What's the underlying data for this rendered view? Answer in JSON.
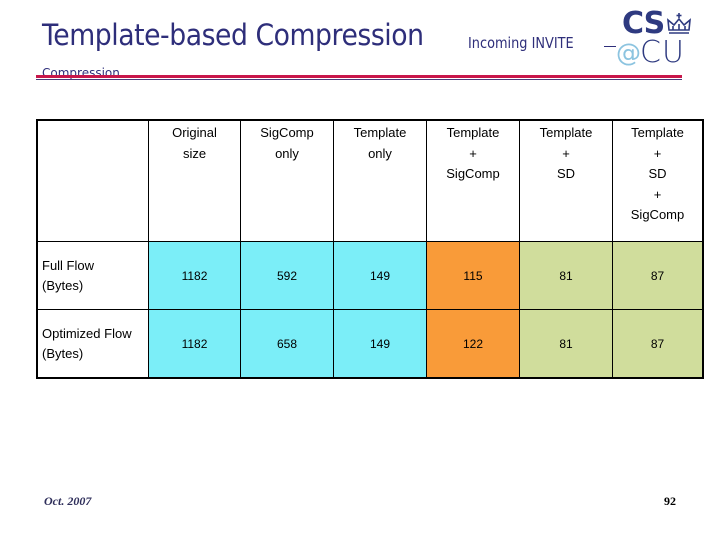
{
  "slide": {
    "title": "Template-based Compression",
    "subtitle_line1": "Incoming INVITE",
    "subtitle_line2": "Compression",
    "logo": {
      "top": "CS",
      "at": "@",
      "bottom": "CU",
      "crown_icon": "crown-icon"
    },
    "colors": {
      "title": "#2e2e7a",
      "rule_primary": "#c8174a",
      "rule_secondary": "#4a3a7a",
      "cell_cyan": "#7beef8",
      "cell_orange": "#f99b39",
      "cell_green": "#d0dd9c"
    }
  },
  "table": {
    "headers": [
      {
        "lines": [
          ""
        ]
      },
      {
        "lines": [
          "Original",
          "size"
        ]
      },
      {
        "lines": [
          "SigComp",
          "only"
        ]
      },
      {
        "lines": [
          "Template",
          "only"
        ]
      },
      {
        "lines": [
          "Template",
          "+",
          "SigComp"
        ]
      },
      {
        "lines": [
          "Template",
          "+",
          "SD"
        ]
      },
      {
        "lines": [
          "Template",
          "+",
          "SD",
          "+",
          "SigComp"
        ]
      }
    ],
    "rows": [
      {
        "label_lines": [
          "Full Flow",
          "(Bytes)"
        ],
        "values": [
          "1182",
          "592",
          "149",
          "115",
          "81",
          "87"
        ]
      },
      {
        "label_lines": [
          "Optimized Flow",
          "(Bytes)"
        ],
        "values": [
          "1182",
          "658",
          "149",
          "122",
          "81",
          "87"
        ]
      }
    ],
    "column_colors": [
      "cyan",
      "cyan",
      "cyan",
      "orange",
      "green",
      "green"
    ]
  },
  "footer": {
    "date": "Oct. 2007",
    "page_number": "92"
  }
}
